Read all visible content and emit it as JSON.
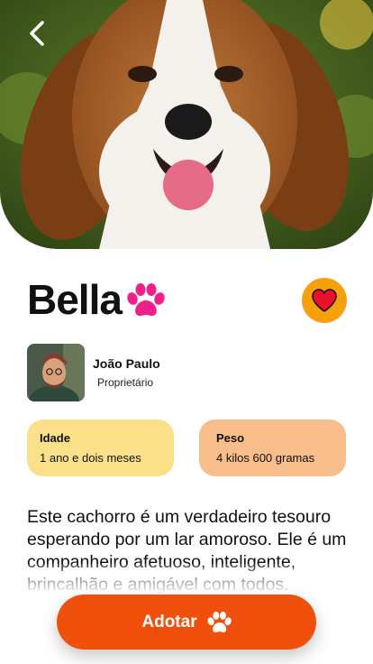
{
  "pet": {
    "name": "Bella",
    "favorited": true
  },
  "owner": {
    "name": "João Paulo",
    "role": "Proprietário"
  },
  "stats": {
    "age_label": "Idade",
    "age_value": "1 ano e dois meses",
    "weight_label": "Peso",
    "weight_value": "4 kilos 600 gramas"
  },
  "description": "Este cachorro é um verdadeiro tesouro esperando por um lar amoroso. Ele é um companheiro afetuoso, inteligente, brincalhão e amigável com todos.",
  "actions": {
    "adopt_label": "Adotar"
  },
  "colors": {
    "accent_orange": "#f0500c",
    "favorite_bg": "#f6a00c",
    "heart": "#e8102a",
    "paw_pink": "#f0208a",
    "age_card": "#fbe08a",
    "weight_card": "#f7bd8a"
  },
  "icons": {
    "back": "chevron-left-icon",
    "name_badge": "paw-icon",
    "favorite": "heart-icon",
    "adopt": "paw-icon"
  }
}
